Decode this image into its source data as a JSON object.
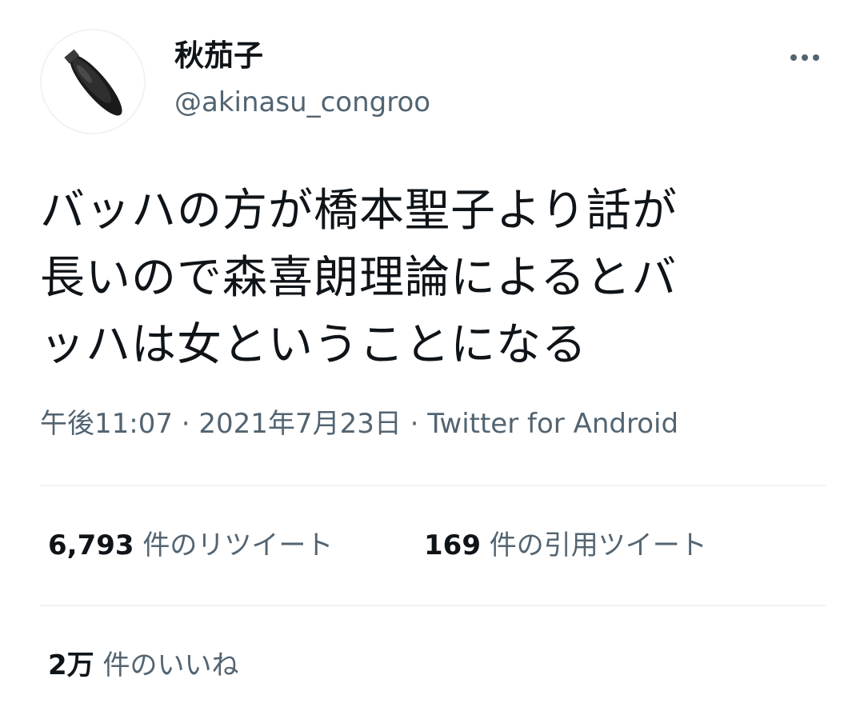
{
  "tweet": {
    "author": {
      "display_name": "秋茄子",
      "handle": "@akinasu_congroo",
      "avatar": "eggplant-pixelated-image"
    },
    "more_icon": "more-horizontal-icon",
    "text": "バッハの方が橋本聖子より話が\n長いので森喜朗理論によるとバ\nッハは女ということになる",
    "timestamp": "午後11:07 · 2021年7月23日 · Twitter for Android",
    "stats": {
      "retweets": {
        "count": "6,793",
        "label": "件のリツイート"
      },
      "quote_tweets": {
        "count": "169",
        "label": "件の引用ツイート"
      },
      "likes": {
        "count": "2万",
        "label": "件のいいね"
      }
    }
  },
  "colors": {
    "text_primary": "#0f1419",
    "text_secondary": "#536471",
    "divider": "#eff3f4",
    "background": "#ffffff"
  }
}
